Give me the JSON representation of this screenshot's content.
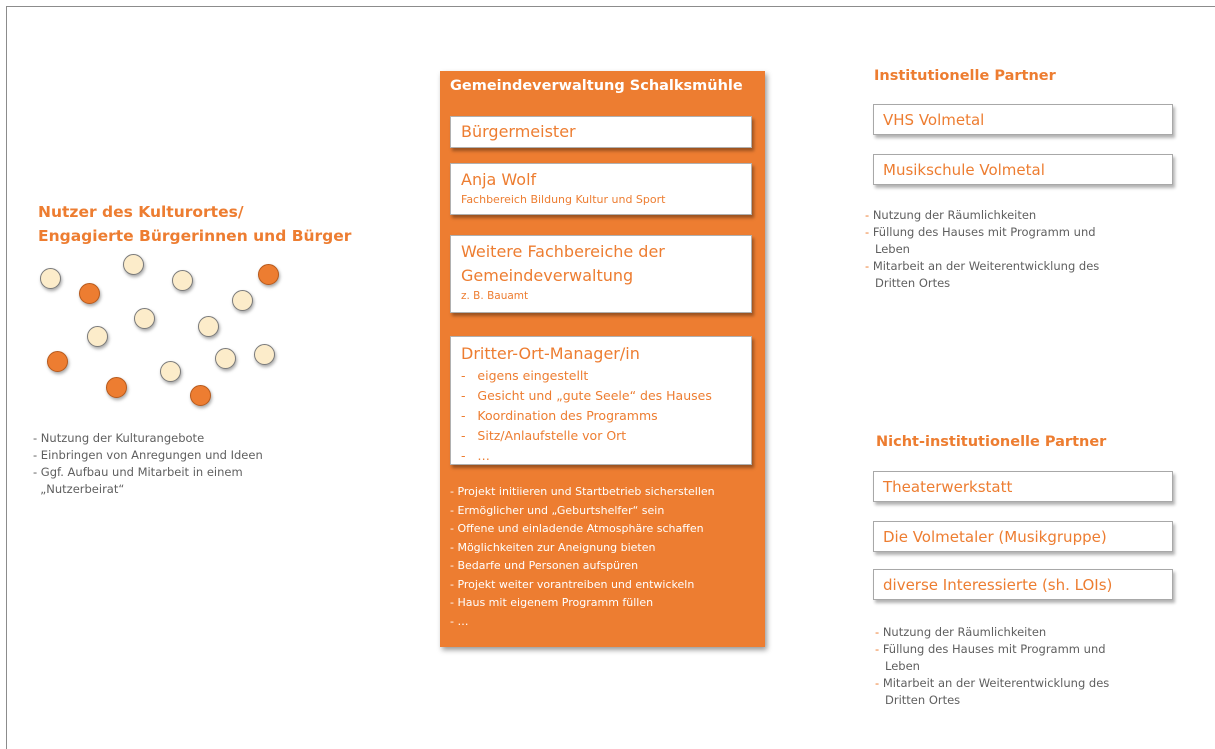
{
  "left": {
    "title_line1": "Nutzer des Kulturortes/",
    "title_line2": "Engagierte Bürgerinnen und Bürger",
    "items": [
      "- Nutzung der Kulturangebote",
      "- Einbringen von Anregungen und Ideen",
      "- Ggf. Aufbau und Mitarbeit in einem",
      "  „Nutzerbeirat“"
    ]
  },
  "center": {
    "title": "Gemeindeverwaltung Schalksmühle",
    "mayor": "Bürgermeister",
    "anja_name": "Anja Wolf",
    "anja_role": "Fachbereich Bildung Kultur und Sport",
    "weitere_line1": "Weitere Fachbereiche der",
    "weitere_line2": "Gemeindeverwaltung",
    "weitere_example": "z. B. Bauamt",
    "manager_title": "Dritter-Ort-Manager/in",
    "manager_items": [
      "-   eigens eingestellt",
      "-   Gesicht und „gute Seele“ des Hauses",
      "-   Koordination des Programms",
      "-   Sitz/Anlaufstelle vor Ort",
      "-   …"
    ],
    "tasks": [
      "- Projekt initiieren und Startbetrieb sicherstellen",
      "- Ermöglicher und „Geburtshelfer“ sein",
      "- Offene und einladende Atmosphäre schaffen",
      "- Möglichkeiten zur Aneignung bieten",
      "- Bedarfe und Personen aufspüren",
      "- Projekt weiter vorantreiben und entwickeln",
      "- Haus mit eigenem Programm füllen",
      "- …"
    ]
  },
  "right": {
    "institutional_title": "Institutionelle Partner",
    "institutional_partners": [
      "VHS Volmetal",
      "Musikschule Volmetal"
    ],
    "institutional_items": [
      "Nutzung der Räumlichkeiten",
      "Füllung des Hauses mit Programm und",
      "Leben",
      "Mitarbeit an der Weiterentwicklung des",
      "Dritten Ortes"
    ],
    "noninstitutional_title": "Nicht-institutionelle Partner",
    "noninstitutional_partners": [
      "Theaterwerkstatt",
      "Die Volmetaler (Musikgruppe)",
      "diverse Interessierte (sh. LOIs)"
    ],
    "noninstitutional_items": [
      "Nutzung der Räumlichkeiten",
      "Füllung des Hauses mit Programm und",
      "Leben",
      "Mitarbeit an der Weiterentwicklung des",
      "Dritten Ortes"
    ]
  },
  "colors": {
    "accent": "#ed7d31",
    "light_dot": "#fcecca",
    "text_grey": "#5f5f5f"
  }
}
